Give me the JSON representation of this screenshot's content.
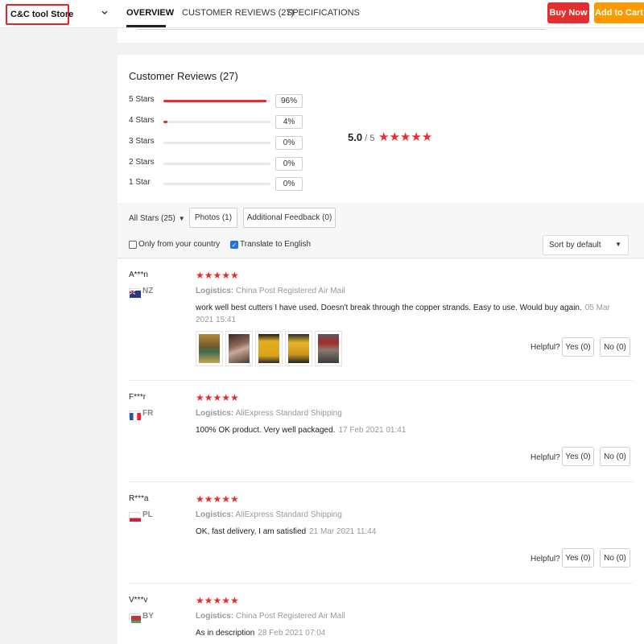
{
  "header": {
    "store_name": "C&C tool Store",
    "tabs": [
      "OVERVIEW",
      "CUSTOMER REVIEWS (27)",
      "SPECIFICATIONS"
    ],
    "buy_now": "Buy Now",
    "add_to_cart": "Add to Cart"
  },
  "reviews": {
    "title": "Customer Reviews (27)",
    "distribution": [
      {
        "label": "5 Stars",
        "pct": "96%",
        "fill": 0.96
      },
      {
        "label": "4 Stars",
        "pct": "4%",
        "fill": 0.04
      },
      {
        "label": "3 Stars",
        "pct": "0%",
        "fill": 0
      },
      {
        "label": "2 Stars",
        "pct": "0%",
        "fill": 0
      },
      {
        "label": "1 Star",
        "pct": "0%",
        "fill": 0
      }
    ],
    "average": "5.0",
    "average_of": " / 5",
    "average_stars": "★★★★★",
    "filters": {
      "all_stars": "All Stars (25)",
      "photos": "Photos (1)",
      "additional": "Additional Feedback (0)",
      "only_country": "Only from your country",
      "translate": "Translate to English",
      "sort": "Sort by default"
    }
  },
  "review_list": [
    {
      "name": "A***n",
      "country": "NZ",
      "stars": "★★★★★",
      "logistics_label": "Logistics:",
      "logistics": "China Post Registered Air Mail",
      "text": "work well best cutters I have used. Doesn't break through the copper strands. Easy to use. Would buy again.",
      "date_a": "05 Mar",
      "date_b": "2021 15:41",
      "helpful": "Helpful?",
      "yes": "Yes (0)",
      "no": "No (0)"
    },
    {
      "name": "F***r",
      "country": "FR",
      "stars": "★★★★★",
      "logistics_label": "Logistics:",
      "logistics": "AliExpress Standard Shipping",
      "text": "100% OK product. Very well packaged.",
      "date": "17 Feb 2021 01:41",
      "helpful": "Helpful?",
      "yes": "Yes (0)",
      "no": "No (0)"
    },
    {
      "name": "R***a",
      "country": "PL",
      "stars": "★★★★★",
      "logistics_label": "Logistics:",
      "logistics": "AliExpress Standard Shipping",
      "text": "OK, fast delivery, I am satisfied",
      "date": "21 Mar 2021 11:44",
      "helpful": "Helpful?",
      "yes": "Yes (0)",
      "no": "No (0)"
    },
    {
      "name": "V***v",
      "country": "BY",
      "stars": "★★★★★",
      "logistics_label": "Logistics:",
      "logistics": "China Post Registered Air Mail",
      "text": "As in description",
      "date": "28 Feb 2021 07:04"
    }
  ],
  "colors": {
    "accent_red": "#e62e2e",
    "accent_orange": "#ff9900"
  }
}
